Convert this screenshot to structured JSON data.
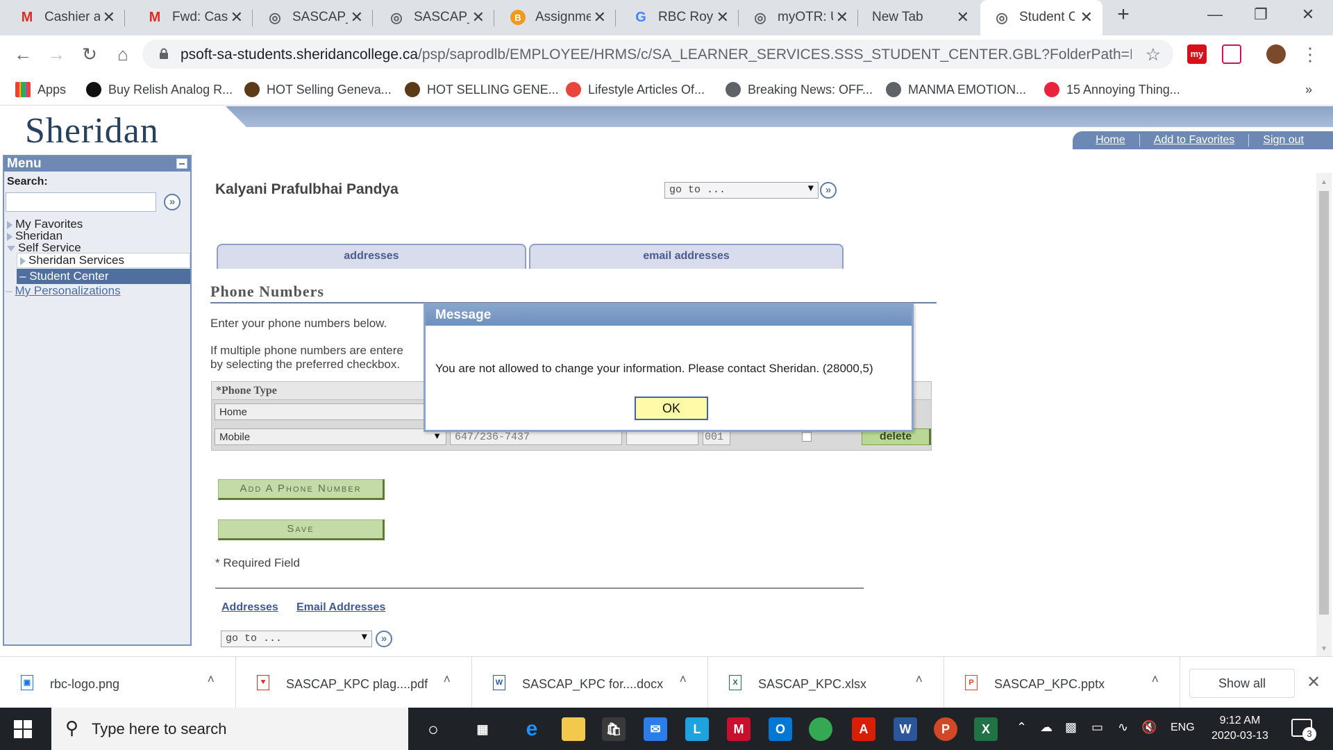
{
  "browser": {
    "tabs": [
      {
        "title": "Cashier at",
        "icon": "gmail-icon",
        "color": "#d93025"
      },
      {
        "title": "Fwd: Case",
        "icon": "gmail-icon",
        "color": "#d93025"
      },
      {
        "title": "SASCAP_K",
        "icon": "globe-icon",
        "color": "#5f6368"
      },
      {
        "title": "SASCAP_K",
        "icon": "globe-icon",
        "color": "#5f6368"
      },
      {
        "title": "Assignme",
        "icon": "brightspace-icon",
        "color": "#f29a1d"
      },
      {
        "title": "RBC Roya",
        "icon": "google-icon",
        "color": "#4285f4"
      },
      {
        "title": "myOTR: U",
        "icon": "globe-icon",
        "color": "#5f6368"
      },
      {
        "title": "New Tab",
        "icon": "",
        "color": ""
      },
      {
        "title": "Student C",
        "icon": "globe-icon",
        "color": "#5f6368"
      }
    ],
    "new_tab_symbol": "+",
    "url_main": "psoft-sa-students.sheridancollege.ca",
    "url_rest": "/psp/saprodlb/EMPLOYEE/HRMS/c/SA_LEARNER_SERVICES.SSS_STUDENT_CENTER.GBL?FolderPath=PORTAL_...",
    "bookmarks": [
      {
        "label": "Apps",
        "color": "#ea4335"
      },
      {
        "label": "Buy Relish Analog R...",
        "color": "#111111"
      },
      {
        "label": "HOT Selling Geneva...",
        "color": "#5b3a17"
      },
      {
        "label": "HOT SELLING GENE...",
        "color": "#5b3a17"
      },
      {
        "label": "Lifestyle Articles Of...",
        "color": "#e8453c"
      },
      {
        "label": "Breaking News: OFF...",
        "color": "#5f6368"
      },
      {
        "label": "MANMA EMOTION...",
        "color": "#5f6368"
      },
      {
        "label": "15 Annoying Thing...",
        "color": "#e8233b"
      }
    ],
    "bookmarks_more": "»"
  },
  "portal": {
    "logo": "Sheridan",
    "top_links": [
      "Home",
      "Add to Favorites",
      "Sign out"
    ],
    "menu": {
      "title": "Menu",
      "search_label": "Search:",
      "items": [
        "My Favorites",
        "Sheridan",
        "Self Service",
        "Sheridan Services",
        "Student Center",
        "My Personalizations"
      ]
    },
    "student_name": "Kalyani Prafulbhai Pandya",
    "goto_label": "go to ...",
    "tabs": [
      "addresses",
      "email addresses"
    ],
    "section_title": "Phone Numbers",
    "intro_line1": "Enter your phone numbers below.",
    "intro_line2": "If multiple phone numbers are entere",
    "intro_line3": "by selecting the preferred checkbox.",
    "grid_header": "*Phone Type",
    "rows": [
      {
        "type": "Home"
      },
      {
        "type": "Mobile",
        "phone": "647/236-7437",
        "ext": "",
        "country": "001",
        "delete": "delete"
      }
    ],
    "add_button": "Add A Phone Number",
    "save_button": "Save",
    "required_note": "* Required Field",
    "bottom_links": [
      "Addresses",
      "Email Addresses"
    ]
  },
  "modal": {
    "title": "Message",
    "message": "You are not allowed to change your information. Please contact Sheridan. (28000,5)",
    "ok": "OK"
  },
  "downloads": {
    "items": [
      {
        "name": "rbc-logo.png",
        "kind": "image-file-icon",
        "color": "#1a73e8"
      },
      {
        "name": "SASCAP_KPC plag....pdf",
        "kind": "pdf-file-icon",
        "color": "#d93025"
      },
      {
        "name": "SASCAP_KPC for....docx",
        "kind": "word-file-icon",
        "color": "#2b579a"
      },
      {
        "name": "SASCAP_KPC.xlsx",
        "kind": "excel-file-icon",
        "color": "#217346"
      },
      {
        "name": "SASCAP_KPC.pptx",
        "kind": "powerpoint-file-icon",
        "color": "#d24726"
      }
    ],
    "show_all": "Show all"
  },
  "taskbar": {
    "search_placeholder": "Type here to search",
    "language": "ENG",
    "time": "9:12 AM",
    "date": "2020-03-13",
    "notifications": "3"
  }
}
